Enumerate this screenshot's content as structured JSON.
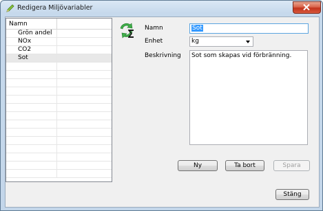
{
  "window": {
    "title": "Redigera Miljövariabler"
  },
  "list": {
    "header": "Namn",
    "items": [
      "Grön andel",
      "NOx",
      "CO2",
      "Sot"
    ],
    "selected": "Sot"
  },
  "form": {
    "name_label": "Namn",
    "name_value": "Sot",
    "unit_label": "Enhet",
    "unit_value": "kg",
    "desc_label": "Beskrivning",
    "desc_value": "Sot som skapas vid förbränning."
  },
  "buttons": {
    "new": "Ny",
    "delete": "Ta bort",
    "save": "Spara",
    "close": "Stäng"
  }
}
